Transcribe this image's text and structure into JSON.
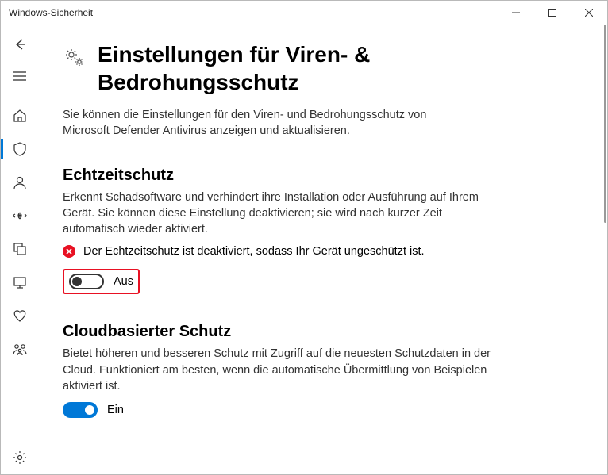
{
  "window": {
    "title": "Windows-Sicherheit"
  },
  "page": {
    "heading": "Einstellungen für Viren- & Bedrohungsschutz",
    "lead": "Sie können die Einstellungen für den Viren- und Bedrohungsschutz von Microsoft Defender Antivirus anzeigen und aktualisieren."
  },
  "realtime": {
    "title": "Echtzeitschutz",
    "desc": "Erkennt Schadsoftware und verhindert ihre Installation oder Ausführung auf Ihrem Gerät. Sie können diese Einstellung deaktivieren; sie wird nach kurzer Zeit automatisch wieder aktiviert.",
    "warning": "Der Echtzeitschutz ist deaktiviert, sodass Ihr Gerät ungeschützt ist.",
    "toggle_state": "off",
    "toggle_label": "Aus"
  },
  "cloud": {
    "title": "Cloudbasierter Schutz",
    "desc": "Bietet höheren und besseren Schutz mit Zugriff auf die neuesten Schutzdaten in der Cloud. Funktioniert am besten, wenn die automatische Übermittlung von Beispielen aktiviert ist.",
    "toggle_state": "on",
    "toggle_label": "Ein"
  },
  "sidebar": {
    "items": [
      "back",
      "menu",
      "home",
      "shield",
      "account",
      "network",
      "app",
      "device",
      "health",
      "family"
    ],
    "active": "shield",
    "footer": "settings"
  }
}
